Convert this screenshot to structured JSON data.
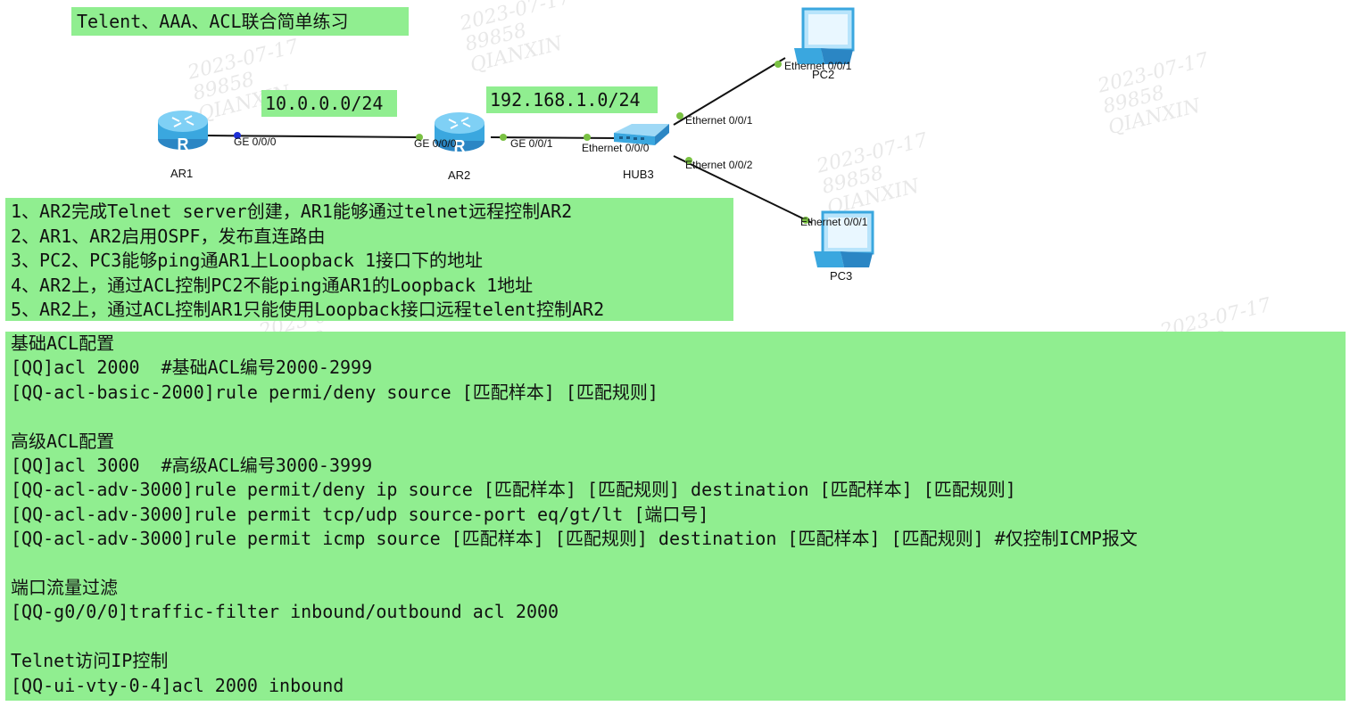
{
  "title": "Telent、AAA、ACL联合简单练习",
  "subnets": {
    "left": "10.0.0.0/24",
    "right": "192.168.1.0/24"
  },
  "devices": {
    "ar1": "AR1",
    "ar2": "AR2",
    "hub3": "HUB3",
    "pc2": "PC2",
    "pc3": "PC3"
  },
  "ports": {
    "ar1_ge000": "GE 0/0/0",
    "ar2_ge000": "GE 0/0/0",
    "ar2_ge001": "GE 0/0/1",
    "hub_e000": "Ethernet 0/0/0",
    "hub_e001": "Ethernet 0/0/1",
    "hub_e002": "Ethernet 0/0/2",
    "pc2_e001": "Ethernet 0/0/1",
    "pc3_e001": "Ethernet 0/0/1"
  },
  "tasks": [
    "1、AR2完成Telnet server创建，AR1能够通过telnet远程控制AR2",
    "2、AR1、AR2启用OSPF，发布直连路由",
    "3、PC2、PC3能够ping通AR1上Loopback 1接口下的地址",
    "4、AR2上，通过ACL控制PC2不能ping通AR1的Loopback 1地址",
    "5、AR2上，通过ACL控制AR1只能使用Loopback接口远程telent控制AR2"
  ],
  "config": {
    "basic_heading": "基础ACL配置",
    "basic_lines": [
      "[QQ]acl 2000  #基础ACL编号2000-2999",
      "[QQ-acl-basic-2000]rule permi/deny source [匹配样本] [匹配规则]"
    ],
    "adv_heading": "高级ACL配置",
    "adv_lines": [
      "[QQ]acl 3000  #高级ACL编号3000-3999",
      "[QQ-acl-adv-3000]rule permit/deny ip source [匹配样本] [匹配规则] destination [匹配样本] [匹配规则]",
      "[QQ-acl-adv-3000]rule permit tcp/udp source-port eq/gt/lt [端口号]",
      "[QQ-acl-adv-3000]rule permit icmp source [匹配样本] [匹配规则] destination [匹配样本] [匹配规则] #仅控制ICMP报文"
    ],
    "filter_heading": "端口流量过滤",
    "filter_lines": [
      "[QQ-g0/0/0]traffic-filter inbound/outbound acl 2000"
    ],
    "telnet_heading": "Telnet访问IP控制",
    "telnet_lines": [
      "[QQ-ui-vty-0-4]acl 2000 inbound"
    ]
  },
  "watermark": "2023-07-17\n89858\nQIANXIN",
  "colors": {
    "highlight": "#90ee90",
    "router": "#3aa7df",
    "link": "#111111",
    "port_dot": "#7ac143"
  },
  "icons": {
    "router": "router-icon",
    "hub": "hub-icon",
    "pc": "pc-icon"
  }
}
